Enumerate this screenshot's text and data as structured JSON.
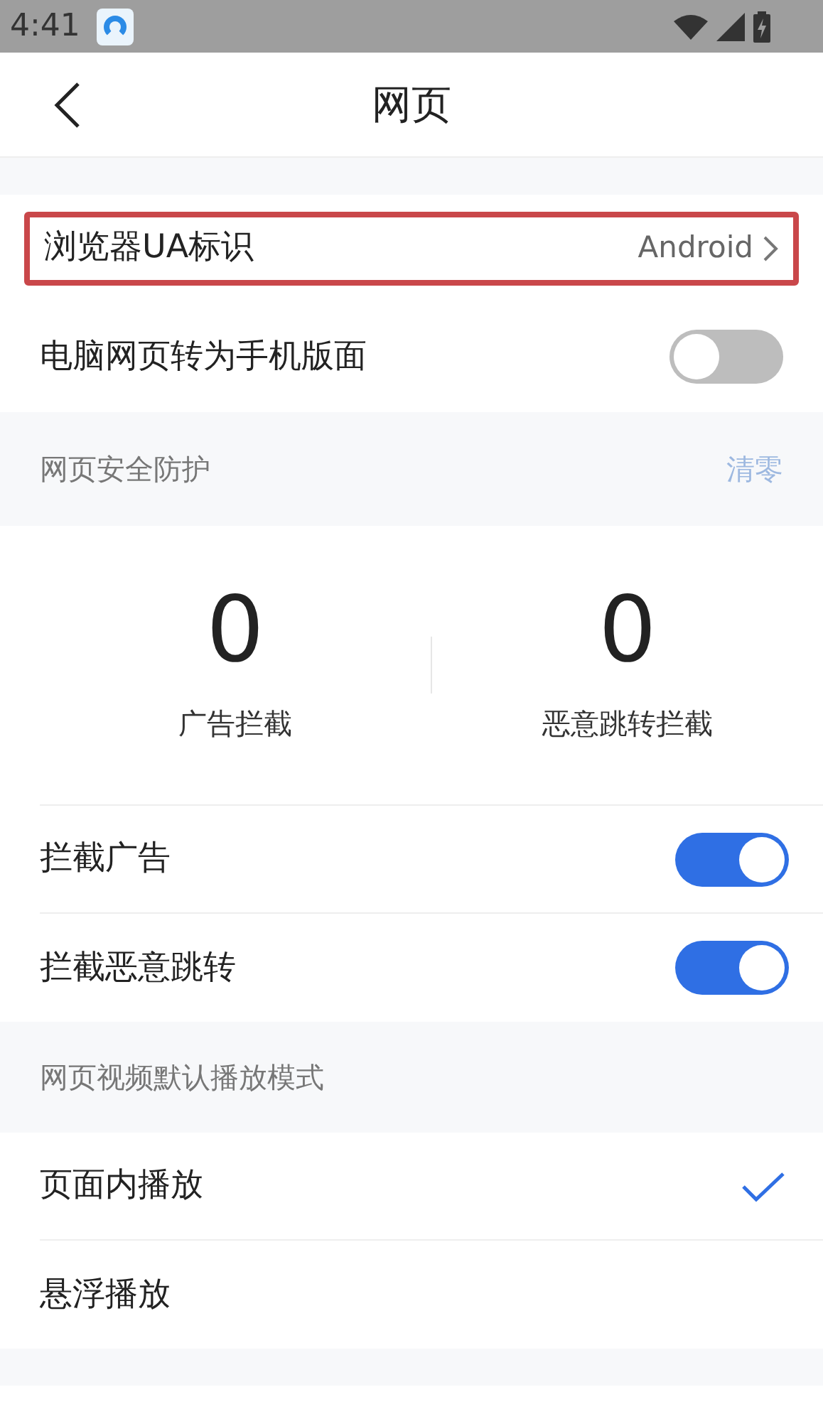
{
  "status_bar": {
    "time": "4:41"
  },
  "header": {
    "title": "网页"
  },
  "ua_row": {
    "label": "浏览器UA标识",
    "value": "Android",
    "highlighted": true
  },
  "mobile_toggle": {
    "label": "电脑网页转为手机版面",
    "on": false
  },
  "security": {
    "title": "网页安全防护",
    "action": "清零",
    "stats": [
      {
        "value": "0",
        "label": "广告拦截"
      },
      {
        "value": "0",
        "label": "恶意跳转拦截"
      }
    ],
    "toggles": [
      {
        "label": "拦截广告",
        "on": true
      },
      {
        "label": "拦截恶意跳转",
        "on": true
      }
    ]
  },
  "video": {
    "title": "网页视频默认播放模式",
    "options": [
      {
        "label": "页面内播放",
        "selected": true
      },
      {
        "label": "悬浮播放",
        "selected": false
      }
    ]
  }
}
